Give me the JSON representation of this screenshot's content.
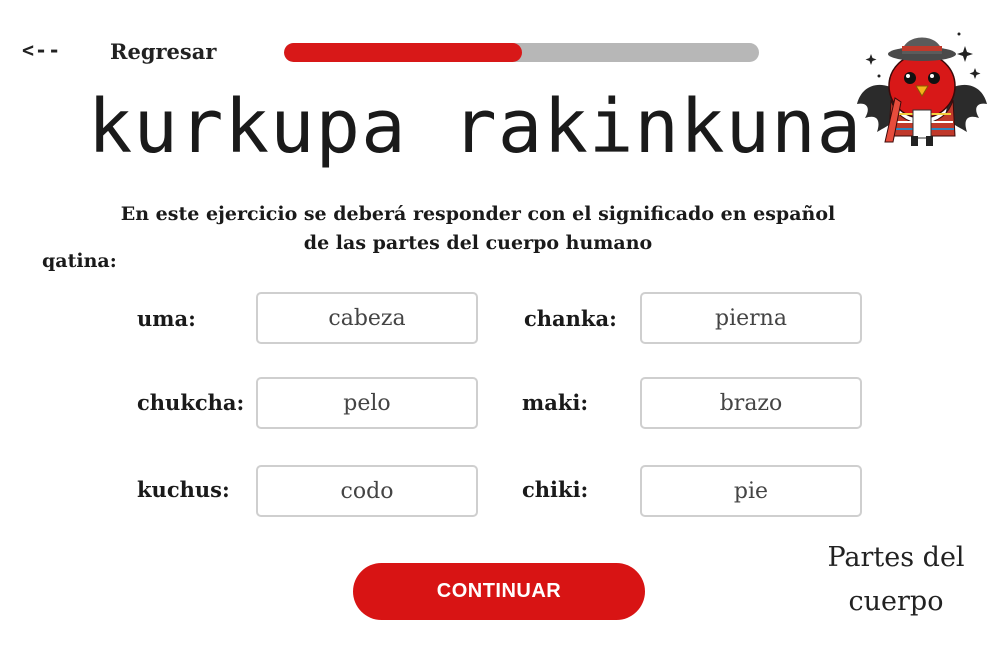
{
  "nav": {
    "back_arrow": "<--",
    "back_label": "Regresar"
  },
  "progress": {
    "fraction": 0.5
  },
  "mascot": {
    "icon": "bird-mascot-icon",
    "colors": {
      "body": "#d81818",
      "wings": "#2b2b2b",
      "poncho": "#c0392b",
      "hat": "#555555"
    }
  },
  "title": "kurkupa rakinkuna",
  "instructions": "En este ejercicio se deberá responder con el significado en español de las partes del cuerpo humano",
  "qatina_label": "qatina:",
  "fields": [
    {
      "label": "uma:",
      "value": "cabeza"
    },
    {
      "label": "chanka:",
      "value": "pierna"
    },
    {
      "label": "chukcha:",
      "value": "pelo"
    },
    {
      "label": "maki:",
      "value": "brazo"
    },
    {
      "label": "kuchus:",
      "value": "codo"
    },
    {
      "label": "chiki:",
      "value": "pie"
    }
  ],
  "continue_label": "CONTINUAR",
  "corner_caption": "Partes del cuerpo",
  "colors": {
    "accent": "#d81818",
    "track": "#b7b7b7",
    "border": "#cfcfcf"
  }
}
